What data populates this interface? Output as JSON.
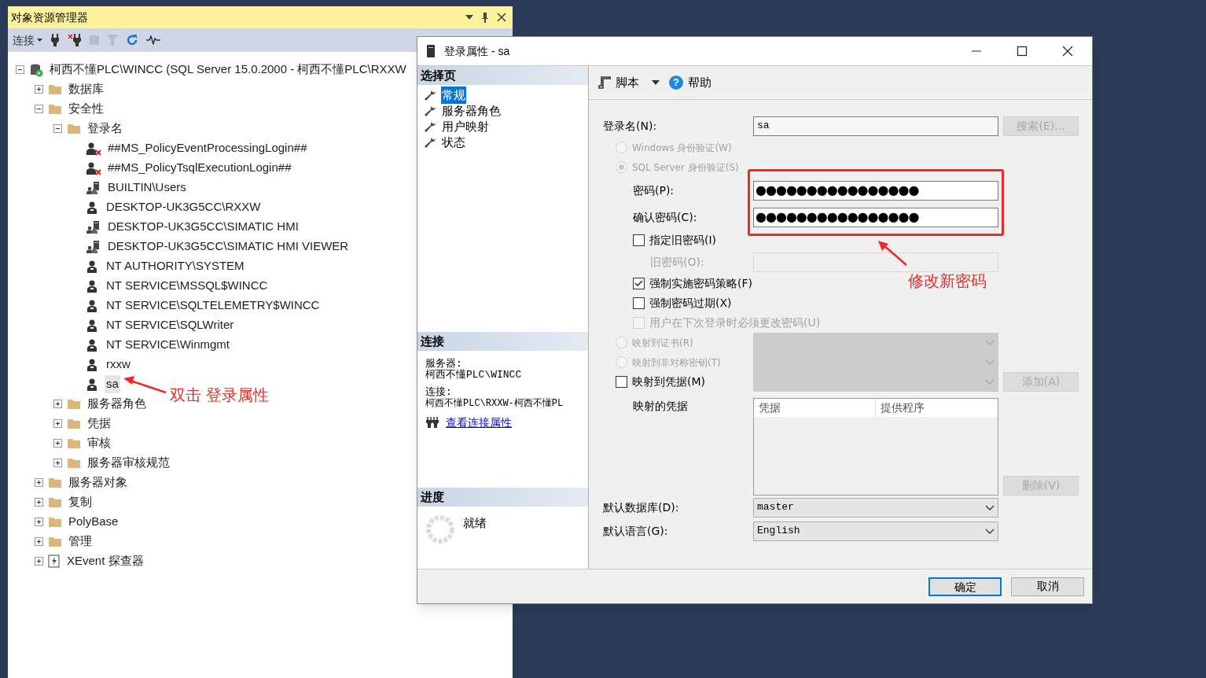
{
  "object_explorer": {
    "title": "对象资源管理器",
    "toolbar": {
      "connect": "连接"
    },
    "tree": [
      {
        "label": "柯西不懂PLC\\WINCC (SQL Server 15.0.2000 - 柯西不懂PLC\\RXXW",
        "kind": "server",
        "expanded": true,
        "selected": false,
        "children": [
          {
            "label": "数据库",
            "kind": "folder",
            "expanded": false,
            "selected": false
          },
          {
            "label": "安全性",
            "kind": "folder",
            "expanded": true,
            "selected": false,
            "children": [
              {
                "label": "登录名",
                "kind": "folder",
                "expanded": true,
                "selected": false,
                "children": [
                  {
                    "label": "##MS_PolicyEventProcessingLogin##",
                    "kind": "login-disabled",
                    "selected": false
                  },
                  {
                    "label": "##MS_PolicyTsqlExecutionLogin##",
                    "kind": "login-disabled",
                    "selected": false
                  },
                  {
                    "label": "BUILTIN\\Users",
                    "kind": "group",
                    "selected": false
                  },
                  {
                    "label": "DESKTOP-UK3G5CC\\RXXW",
                    "kind": "login",
                    "selected": false
                  },
                  {
                    "label": "DESKTOP-UK3G5CC\\SIMATIC HMI",
                    "kind": "group",
                    "selected": false
                  },
                  {
                    "label": "DESKTOP-UK3G5CC\\SIMATIC HMI VIEWER",
                    "kind": "group",
                    "selected": false
                  },
                  {
                    "label": "NT AUTHORITY\\SYSTEM",
                    "kind": "login",
                    "selected": false
                  },
                  {
                    "label": "NT SERVICE\\MSSQL$WINCC",
                    "kind": "login",
                    "selected": false
                  },
                  {
                    "label": "NT SERVICE\\SQLTELEMETRY$WINCC",
                    "kind": "login",
                    "selected": false
                  },
                  {
                    "label": "NT SERVICE\\SQLWriter",
                    "kind": "login",
                    "selected": false
                  },
                  {
                    "label": "NT SERVICE\\Winmgmt",
                    "kind": "login",
                    "selected": false
                  },
                  {
                    "label": "rxxw",
                    "kind": "login",
                    "selected": false
                  },
                  {
                    "label": "sa",
                    "kind": "login",
                    "selected": true
                  }
                ]
              },
              {
                "label": "服务器角色",
                "kind": "folder",
                "expanded": false,
                "selected": false
              },
              {
                "label": "凭据",
                "kind": "folder",
                "expanded": false,
                "selected": false
              },
              {
                "label": "审核",
                "kind": "folder",
                "expanded": false,
                "selected": false
              },
              {
                "label": "服务器审核规范",
                "kind": "folder",
                "expanded": false,
                "selected": false
              }
            ]
          },
          {
            "label": "服务器对象",
            "kind": "folder",
            "expanded": false,
            "selected": false
          },
          {
            "label": "复制",
            "kind": "folder",
            "expanded": false,
            "selected": false
          },
          {
            "label": "PolyBase",
            "kind": "folder",
            "expanded": false,
            "selected": false
          },
          {
            "label": "管理",
            "kind": "folder",
            "expanded": false,
            "selected": false
          },
          {
            "label": "XEvent 探查器",
            "kind": "xevent",
            "expanded": false,
            "selected": false
          }
        ]
      }
    ]
  },
  "dialog": {
    "title": "登录属性 - sa",
    "select_page": {
      "header": "选择页",
      "pages": [
        {
          "label": "常规",
          "selected": true
        },
        {
          "label": "服务器角色",
          "selected": false
        },
        {
          "label": "用户映射",
          "selected": false
        },
        {
          "label": "状态",
          "selected": false
        }
      ]
    },
    "connection": {
      "header": "连接",
      "server_label": "服务器:",
      "server": "柯西不懂PLC\\WINCC",
      "connection_label": "连接:",
      "connection": "柯西不懂PLC\\RXXW-柯西不懂PL",
      "link": "查看连接属性"
    },
    "progress": {
      "header": "进度",
      "status": "就绪"
    },
    "toolbar": {
      "script": "脚本",
      "help_icon": "?",
      "help": "帮助"
    },
    "form": [
      {
        "kind": "text",
        "label": "登录名(N):",
        "value": "sa",
        "disabled": false,
        "button": {
          "label": "搜索(E)...",
          "disabled": true
        }
      },
      {
        "kind": "radio",
        "label": "Windows 身份验证(W)",
        "selected": false,
        "disabled": true
      },
      {
        "kind": "radio",
        "label": "SQL Server 身份验证(S)",
        "selected": true,
        "disabled": true,
        "children": [
          {
            "kind": "password",
            "label": "密码(P):",
            "value": "●●●●●●●●●●●●●●●●"
          },
          {
            "kind": "password",
            "label": "确认密码(C):",
            "value": "●●●●●●●●●●●●●●●●"
          },
          {
            "kind": "checkbox",
            "label": "指定旧密码(I)",
            "checked": false,
            "disabled": false,
            "children": [
              {
                "kind": "text",
                "label": "旧密码(O):",
                "disabled": true
              }
            ]
          },
          {
            "kind": "checkbox",
            "label": "强制实施密码策略(F)",
            "checked": true,
            "disabled": false
          },
          {
            "kind": "checkbox",
            "label": "强制密码过期(X)",
            "checked": false,
            "disabled": false
          },
          {
            "kind": "checkbox",
            "label": "用户在下次登录时必须更改密码(U)",
            "checked": false,
            "disabled": true
          }
        ]
      },
      {
        "kind": "radio",
        "label": "映射到证书(R)",
        "selected": false,
        "disabled": true,
        "select": {
          "disabled": true
        }
      },
      {
        "kind": "radio",
        "label": "映射到非对称密钥(T)",
        "selected": false,
        "disabled": true,
        "select": {
          "disabled": true
        }
      },
      {
        "kind": "checkbox",
        "label": "映射到凭据(M)",
        "checked": false,
        "disabled": false,
        "select": {
          "disabled": true
        },
        "button": {
          "label": "添加(A)",
          "disabled": true
        },
        "children": [
          {
            "kind": "list",
            "label": "映射的凭据",
            "columns": [
              "凭据",
              "提供程序"
            ],
            "button": {
              "label": "删除(V)",
              "disabled": true
            }
          }
        ]
      },
      {
        "kind": "select",
        "label": "默认数据库(D):",
        "value": "master",
        "disabled": false
      },
      {
        "kind": "select",
        "label": "默认语言(G):",
        "value": "English",
        "disabled": false
      }
    ],
    "buttons": [
      {
        "label": "确定",
        "default": true
      },
      {
        "label": "取消",
        "default": false
      }
    ]
  },
  "annotations": [
    {
      "kind": "tree",
      "text": "双击 登录属性"
    },
    {
      "kind": "password",
      "text": "修改新密码"
    }
  ]
}
